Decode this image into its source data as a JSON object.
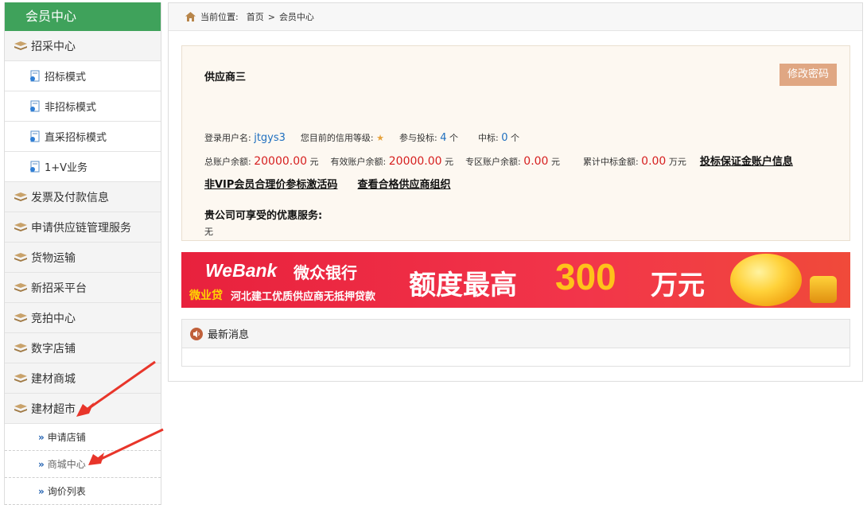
{
  "sidebar": {
    "title": "会员中心",
    "items": [
      {
        "label": "招采中心",
        "type": "group"
      },
      {
        "label": "招标模式",
        "type": "sub"
      },
      {
        "label": "非招标模式",
        "type": "sub"
      },
      {
        "label": "直采招标模式",
        "type": "sub"
      },
      {
        "label": "1+V业务",
        "type": "sub"
      },
      {
        "label": "发票及付款信息",
        "type": "group"
      },
      {
        "label": "申请供应链管理服务",
        "type": "group"
      },
      {
        "label": "货物运输",
        "type": "group"
      },
      {
        "label": "新招采平台",
        "type": "group"
      },
      {
        "label": "竞拍中心",
        "type": "group"
      },
      {
        "label": "数字店铺",
        "type": "group"
      },
      {
        "label": "建材商城",
        "type": "group"
      },
      {
        "label": "建材超市",
        "type": "group"
      }
    ],
    "subitems": [
      {
        "label": "申请店铺"
      },
      {
        "label": "商城中心"
      },
      {
        "label": "询价列表"
      }
    ]
  },
  "breadcrumb": {
    "prefix": "当前位置:",
    "home": "首页",
    "separator": ">",
    "current": "会员中心"
  },
  "account": {
    "company": "供应商三",
    "change_password": "修改密码",
    "username_label": "登录用户名:",
    "username": "jtgys3",
    "credit_label": "您目前的信用等级:",
    "credit_star": "★",
    "bid_label": "参与投标:",
    "bid_count": "4",
    "bid_unit": "个",
    "win_label": "中标:",
    "win_count": "0",
    "win_unit": "个",
    "total_balance_label": "总账户余额:",
    "total_balance": "20000.00",
    "total_balance_unit": "元",
    "valid_balance_label": "有效账户余额:",
    "valid_balance": "20000.00",
    "valid_balance_unit": "元",
    "special_balance_label": "专区账户余额:",
    "special_balance": "0.00",
    "special_balance_unit": "元",
    "cumulative_label": "累计中标金额:",
    "cumulative": "0.00",
    "cumulative_unit": "万元",
    "deposit_link": "投标保证金账户信息",
    "vip_link": "非VIP会员合理价参标激活码",
    "qualified_link": "查看合格供应商组织",
    "benefits_label": "贵公司可享受的优惠服务:",
    "benefits_value": "无"
  },
  "banner": {
    "brand": "WeBank",
    "brand_cn": "微众银行",
    "loan": "微业贷",
    "loan_desc": "河北建工优质供应商无抵押贷款",
    "headline": "额度最高",
    "amount": "300",
    "unit": "万元"
  },
  "news": {
    "title": "最新消息"
  },
  "colors": {
    "sidebar_header": "#3fa25b",
    "button": "#e0a783",
    "link_blue": "#1f6fbf",
    "amount_red": "#d61f1f",
    "annotation_arrow": "#e8352a"
  }
}
